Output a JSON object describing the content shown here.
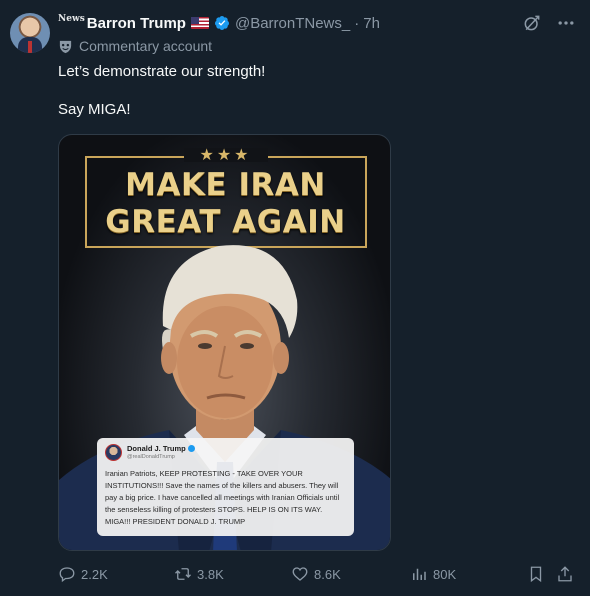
{
  "author": {
    "news_badge": "News",
    "display_name": "Barron Trump",
    "handle": "@BarronTNews_",
    "separator": "·",
    "time": "7h",
    "label": "Commentary account"
  },
  "tweet": {
    "line1": "Let’s demonstrate our strength!",
    "line2": "Say MIGA!"
  },
  "media": {
    "stars": "★★★",
    "headline_line1": "MAKE IRAN",
    "headline_line2": "GREAT AGAIN",
    "quote": {
      "name": "Donald J. Trump",
      "handle": "@realDonaldTrump",
      "body": "Iranian Patriots, KEEP PROTESTING - TAKE OVER YOUR INSTITUTIONS!!! Save the names of the killers and abusers. They will pay a big price. I have cancelled all meetings with Iranian Officials until the senseless killing of protesters STOPS. HELP IS ON ITS WAY. MIGA!!! PRESIDENT DONALD J. TRUMP"
    }
  },
  "actions": {
    "replies": "2.2K",
    "reposts": "3.8K",
    "likes": "8.6K",
    "views": "80K"
  },
  "icons": {
    "verified": "verified-badge-icon",
    "grok": "grok-icon",
    "more": "more-dots-icon",
    "reply": "reply-icon",
    "retweet": "retweet-icon",
    "like": "heart-icon",
    "views": "views-icon",
    "bookmark": "bookmark-icon",
    "share": "share-icon"
  },
  "colors": {
    "background": "#15202b",
    "text_primary": "#f7f9f9",
    "text_secondary": "#8b98a5",
    "verified_blue": "#1d9bf0",
    "headline_gold": "#ead08a"
  }
}
